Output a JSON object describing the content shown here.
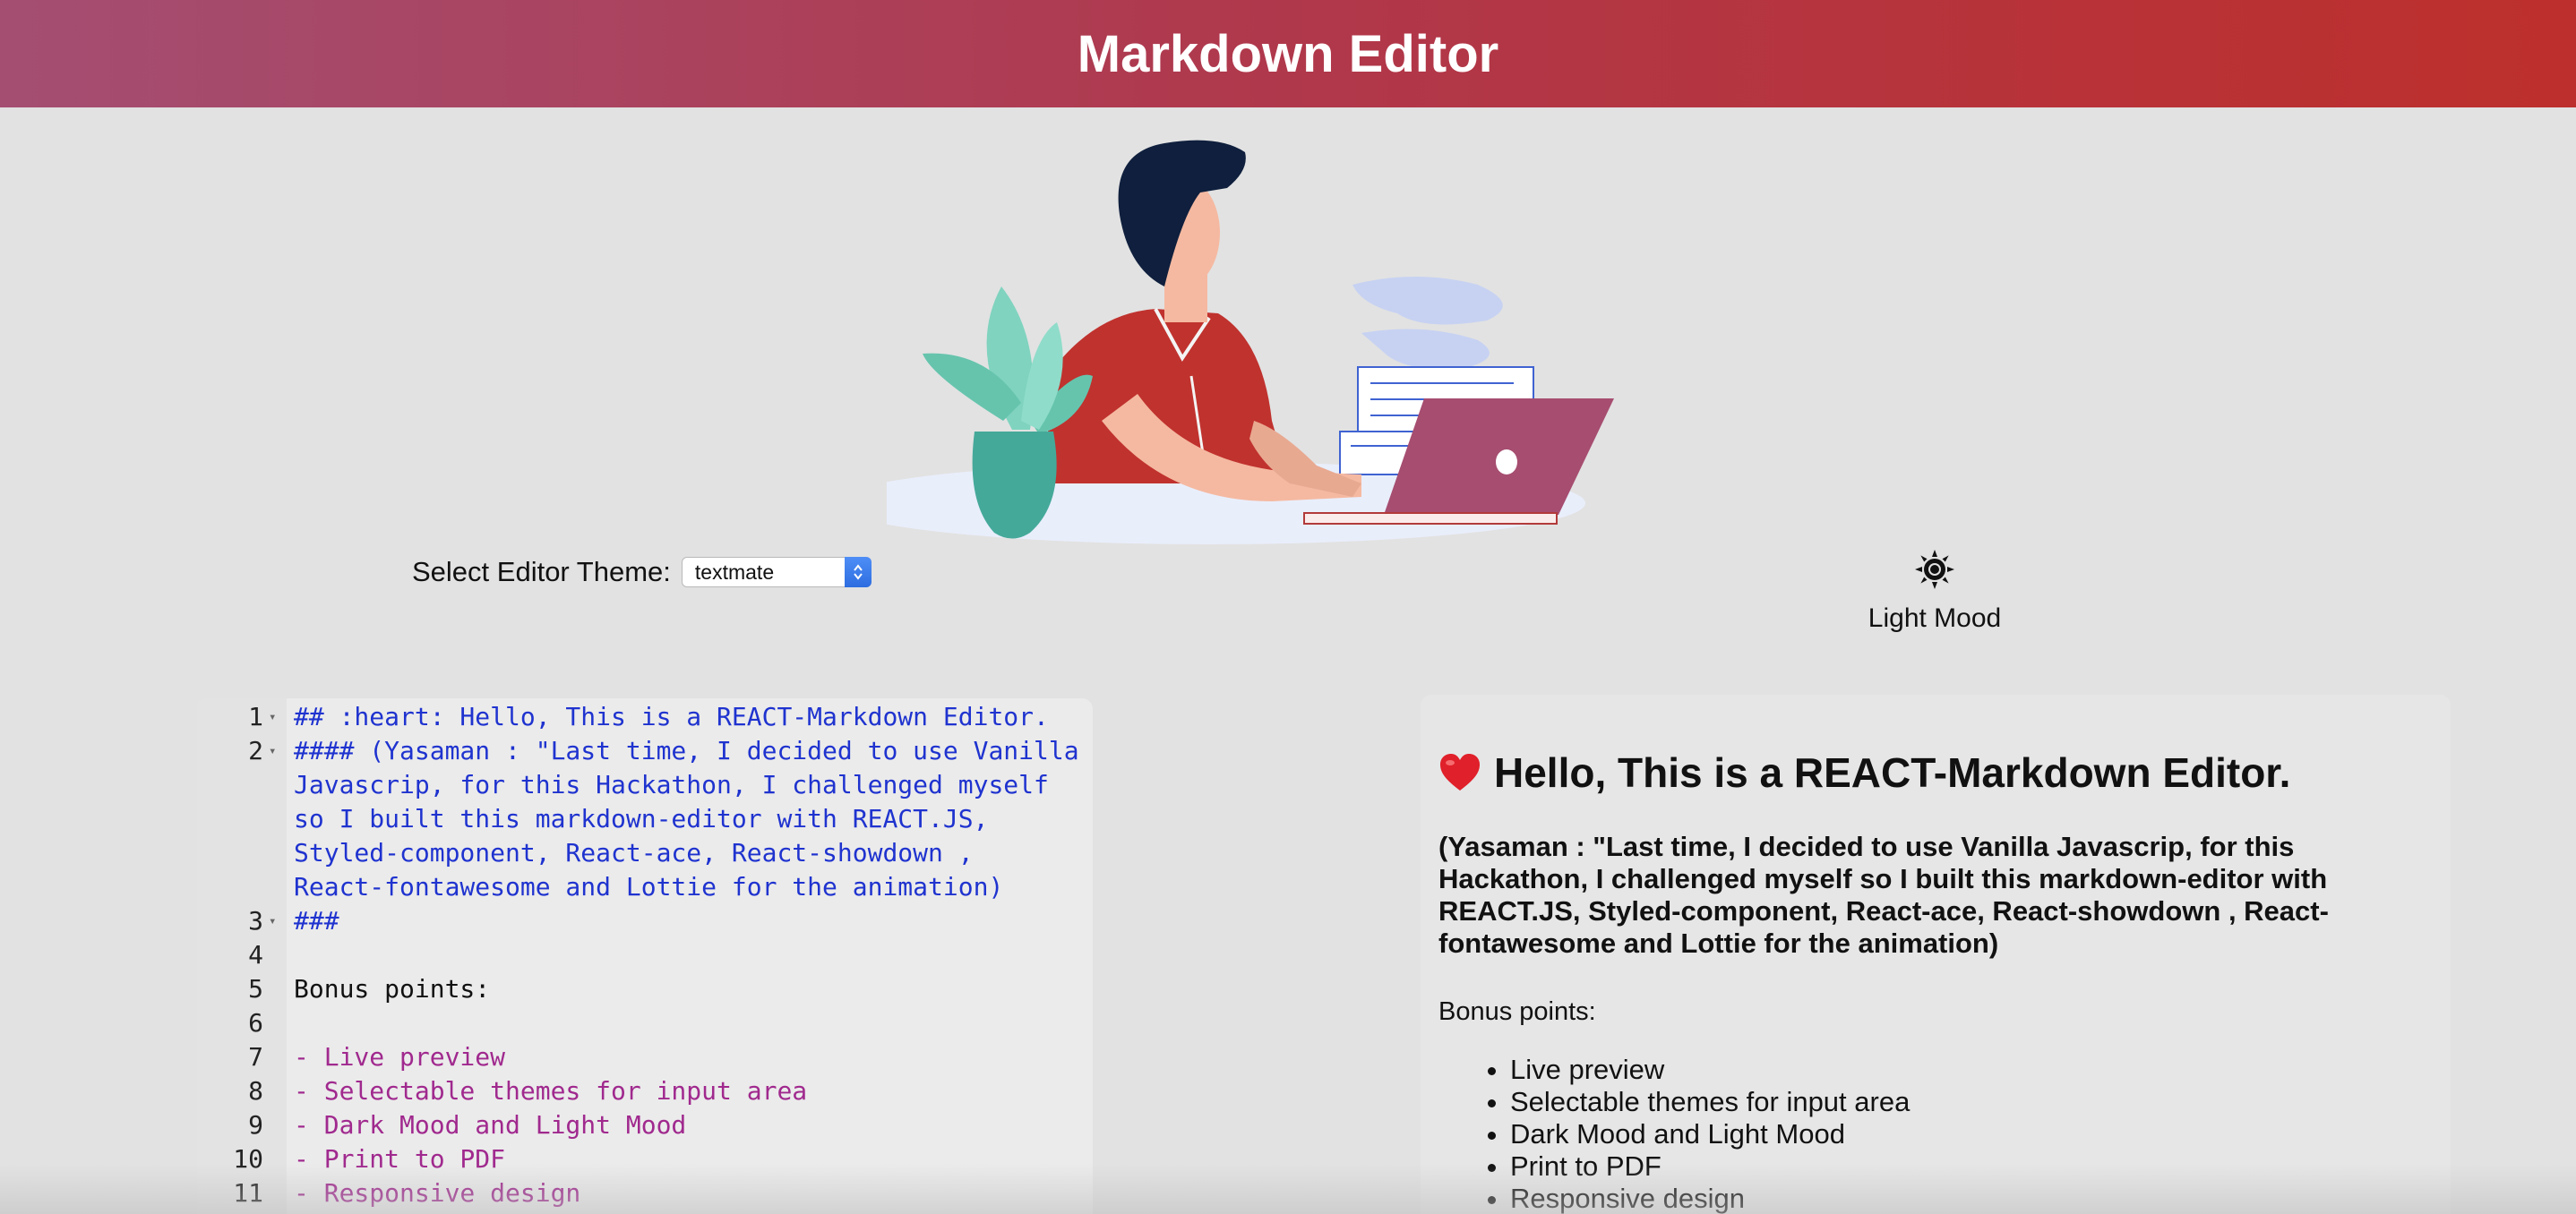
{
  "header": {
    "title": "Markdown Editor"
  },
  "theme_selector": {
    "label": "Select Editor Theme:",
    "selected": "textmate"
  },
  "mood_toggle": {
    "label": "Light Mood",
    "icon": "sun-icon"
  },
  "editor": {
    "lines": [
      {
        "num": "1",
        "fold": true,
        "style": "c-blue",
        "text": "## :heart: Hello, This is a REACT-Markdown Editor."
      },
      {
        "num": "2",
        "fold": true,
        "style": "c-blue",
        "text": "#### (Yasaman : \"Last time, I decided to use Vanilla"
      },
      {
        "num": "",
        "fold": false,
        "style": "c-blue",
        "text": "Javascrip, for this Hackathon, I challenged myself"
      },
      {
        "num": "",
        "fold": false,
        "style": "c-blue",
        "text": "so I built this markdown-editor with REACT.JS,"
      },
      {
        "num": "",
        "fold": false,
        "style": "c-blue",
        "text": "Styled-component, React-ace, React-showdown ,"
      },
      {
        "num": "",
        "fold": false,
        "style": "c-blue",
        "text": "React-fontawesome and Lottie for the animation)"
      },
      {
        "num": "3",
        "fold": true,
        "style": "c-blue",
        "text": "###"
      },
      {
        "num": "4",
        "fold": false,
        "style": "c-black",
        "text": ""
      },
      {
        "num": "5",
        "fold": false,
        "style": "c-black",
        "text": "Bonus points:"
      },
      {
        "num": "6",
        "fold": false,
        "style": "c-black",
        "text": ""
      },
      {
        "num": "7",
        "fold": false,
        "style": "c-magenta",
        "text": "- Live preview"
      },
      {
        "num": "8",
        "fold": false,
        "style": "c-magenta",
        "text": "- Selectable themes for input area"
      },
      {
        "num": "9",
        "fold": false,
        "style": "c-magenta",
        "text": "- Dark Mood and Light Mood"
      },
      {
        "num": "10",
        "fold": false,
        "style": "c-magenta",
        "text": "- Print to PDF"
      },
      {
        "num": "11",
        "fold": false,
        "style": "c-magenta",
        "text": "- Responsive design"
      }
    ]
  },
  "preview": {
    "heading": "Hello, This is a REACT-Markdown Editor.",
    "heading_icon": "heart-icon",
    "subheading": "(Yasaman : \"Last time, I decided to use Vanilla Javascrip, for this Hackathon, I challenged myself so I built this markdown-editor with REACT.JS, Styled-component, React-ace, React-showdown , React-fontawesome and Lottie for the animation)",
    "paragraph": "Bonus points:",
    "list": [
      "Live preview",
      "Selectable themes for input area",
      "Dark Mood and Light Mood",
      "Print to PDF",
      "Responsive design"
    ]
  },
  "colors": {
    "header_gradient_start": "#a44e72",
    "header_gradient_end": "#bd2f2c",
    "page_background": "#e2e2e2",
    "code_heading": "#1f33cf",
    "code_list": "#a0298e"
  }
}
